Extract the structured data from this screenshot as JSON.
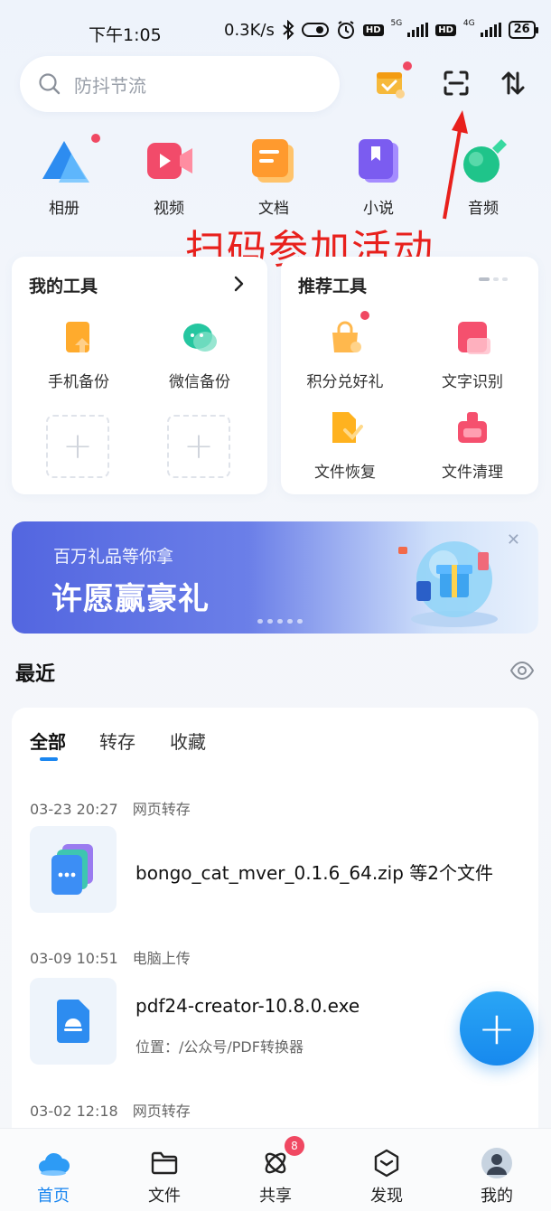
{
  "status_bar": {
    "time": "下午1:05",
    "net_speed": "0.3K/s",
    "sim1_tag": "5G",
    "sim2_tag": "4G",
    "hd": "HD",
    "battery": "26"
  },
  "search": {
    "placeholder": "防抖节流"
  },
  "annotation": "扫码参加活动",
  "categories": [
    {
      "label": "相册",
      "icon": "album-icon"
    },
    {
      "label": "视频",
      "icon": "video-icon"
    },
    {
      "label": "文档",
      "icon": "document-icon"
    },
    {
      "label": "小说",
      "icon": "novel-icon"
    },
    {
      "label": "音频",
      "icon": "audio-icon"
    }
  ],
  "my_tools": {
    "title": "我的工具",
    "items": [
      {
        "label": "手机备份",
        "icon": "phone-backup-icon"
      },
      {
        "label": "微信备份",
        "icon": "wechat-backup-icon"
      }
    ]
  },
  "recommended_tools": {
    "title": "推荐工具",
    "items": [
      {
        "label": "积分兑好礼",
        "icon": "gift-bag-icon"
      },
      {
        "label": "文字识别",
        "icon": "ocr-icon"
      },
      {
        "label": "文件恢复",
        "icon": "file-restore-icon"
      },
      {
        "label": "文件清理",
        "icon": "file-clean-icon"
      }
    ]
  },
  "banner": {
    "subtitle": "百万礼品等你拿",
    "title": "许愿赢豪礼",
    "close": "✕"
  },
  "recent": {
    "title": "最近",
    "tabs": [
      "全部",
      "转存",
      "收藏"
    ],
    "items": [
      {
        "time": "03-23 20:27",
        "source": "网页转存",
        "name": "bongo_cat_mver_0.1.6_64.zip 等2个文件",
        "location": ""
      },
      {
        "time": "03-09 10:51",
        "source": "电脑上传",
        "name": "pdf24-creator-10.8.0.exe",
        "location": "位置：/公众号/PDF转换器"
      },
      {
        "time": "03-02 12:18",
        "source": "网页转存",
        "name": "",
        "location": ""
      }
    ]
  },
  "fab": "+",
  "bottom_nav": [
    {
      "label": "首页",
      "active": true
    },
    {
      "label": "文件",
      "active": false
    },
    {
      "label": "共享",
      "active": false,
      "badge": "8"
    },
    {
      "label": "发现",
      "active": false
    },
    {
      "label": "我的",
      "active": false
    }
  ],
  "colors": {
    "accent": "#1a86f0",
    "badge": "#f04862",
    "annotation": "#e8201c"
  }
}
